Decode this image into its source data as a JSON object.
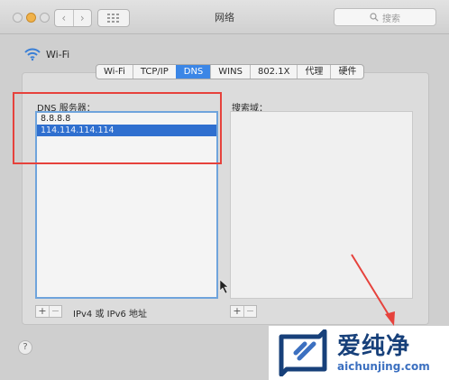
{
  "window": {
    "title": "网络",
    "search_placeholder": "搜索",
    "nav_back": "‹",
    "nav_forward": "›"
  },
  "header": {
    "network_name": "Wi-Fi"
  },
  "tabs": [
    {
      "label": "Wi-Fi",
      "active": false
    },
    {
      "label": "TCP/IP",
      "active": false
    },
    {
      "label": "DNS",
      "active": true
    },
    {
      "label": "WINS",
      "active": false
    },
    {
      "label": "802.1X",
      "active": false
    },
    {
      "label": "代理",
      "active": false
    },
    {
      "label": "硬件",
      "active": false
    }
  ],
  "dns": {
    "label": "DNS 服务器：",
    "servers": [
      "8.8.8.8",
      "114.114.114.114"
    ],
    "selected_index": 1,
    "add_label": "+",
    "remove_label": "−",
    "note": "IPv4 或 IPv6 地址"
  },
  "search_domains": {
    "label": "搜索域：",
    "add_label": "+",
    "remove_label": "−"
  },
  "help_label": "?",
  "watermark": {
    "name": "爱纯净",
    "url": "aichunjing.com"
  },
  "colors": {
    "accent": "#3b86e6",
    "selection": "#2f6fcf",
    "annotation": "#e6423c",
    "logo_dark": "#17407a",
    "logo_light": "#3c70c0"
  },
  "icons": {
    "wifi": "wifi-icon",
    "search": "search-icon",
    "grid": "grid-icon",
    "logo": "logo-icon"
  }
}
